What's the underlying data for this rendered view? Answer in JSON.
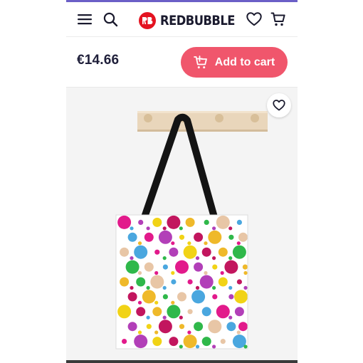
{
  "header": {
    "brand": "REDBUBBLE",
    "icons": [
      "menu-icon",
      "search-icon",
      "heart-icon",
      "cart-icon"
    ]
  },
  "product": {
    "price": "€14.66",
    "add_to_cart_label": "Add to cart"
  },
  "colors": {
    "accent": "#f0566c",
    "brand_red": "#e41321",
    "header_accent": "#6b5fc7",
    "dots": [
      "#e21a8b",
      "#2fb84a",
      "#f1d316",
      "#4aa7df",
      "#efb92a",
      "#b23fb8",
      "#e8c6a6",
      "#c2165e"
    ]
  },
  "hero": {
    "image_icons": [
      "wall-rack",
      "tote-bag",
      "favorite-heart-icon"
    ]
  }
}
